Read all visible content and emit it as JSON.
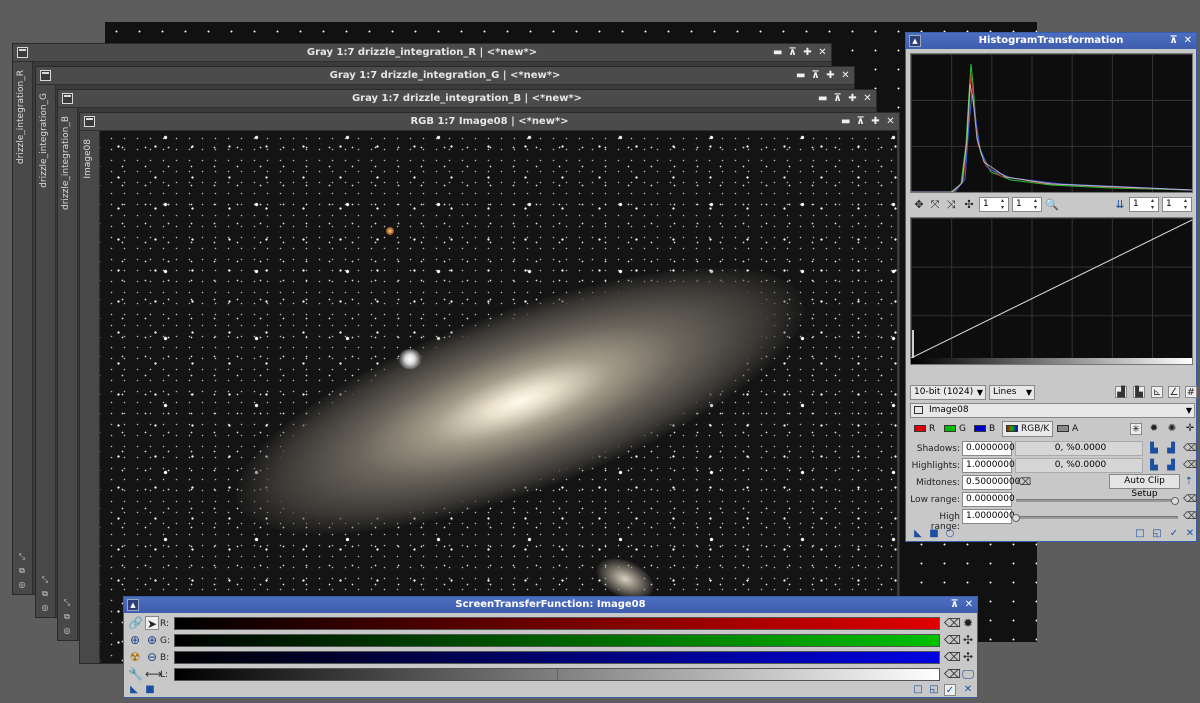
{
  "windows": {
    "back": {
      "title": "Gray 1:7 drizzle_integration_R | <*new*>",
      "tab": "drizzle_integration_R"
    },
    "green": {
      "title": "Gray 1:7 drizzle_integration_G | <*new*>",
      "tab": "drizzle_integration_G"
    },
    "blue": {
      "title": "Gray 1:7 drizzle_integration_B | <*new*>",
      "tab": "drizzle_integration_B"
    },
    "rgb": {
      "title": "RGB 1:7 Image08 | <*new*>",
      "tab": "Image08"
    },
    "buttons": {
      "shade": "▬",
      "restore": "⊼",
      "max": "✚",
      "close": "✕"
    }
  },
  "histogram": {
    "title": "HistogramTransformation",
    "zoom_h": "1",
    "zoom_v": "1",
    "zoom_h2": "1",
    "zoom_v2": "1",
    "resolution": "10-bit (1024)",
    "plot_mode": "Lines",
    "view": "Image08",
    "channels": {
      "r": "R",
      "g": "G",
      "b": "B",
      "rgbk": "RGB/K",
      "a": "A"
    },
    "labels": {
      "shadows": "Shadows:",
      "highlights": "Highlights:",
      "midtones": "Midtones:",
      "low_range": "Low range:",
      "high_range": "High range:"
    },
    "shadows": "0.00000000",
    "shadows_stat": "0, %0.0000",
    "highlights": "1.00000000",
    "highlights_stat": "0, %0.0000",
    "midtones": "0.50000000",
    "low_range": "0.0000000",
    "high_range": "1.0000000",
    "auto_clip_label": "Auto Clip Setup",
    "low_range_fraction": 0.98,
    "high_range_fraction": 0.0
  },
  "stf": {
    "title": "ScreenTransferFunction: Image08",
    "rows": [
      {
        "label": "R:",
        "color": "#e00000"
      },
      {
        "label": "G:",
        "color": "#00c000"
      },
      {
        "label": "B:",
        "color": "#0000e0"
      },
      {
        "label": "L:",
        "color": "#ffffff"
      }
    ],
    "midtone_fraction": 0.5
  },
  "colors": {
    "panel_title": "#4466bb",
    "panel_bg": "#c8c8c8"
  }
}
